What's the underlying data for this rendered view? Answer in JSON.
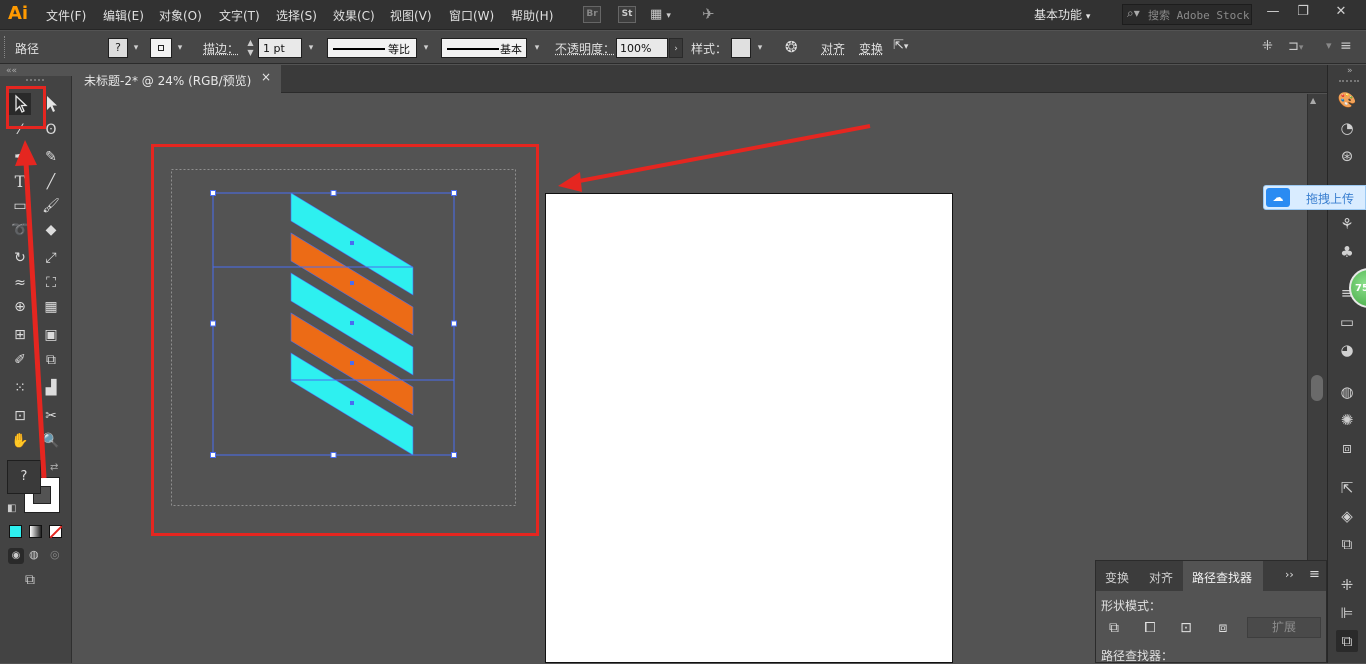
{
  "app": {
    "logo": "Ai",
    "menu": [
      "文件(F)",
      "编辑(E)",
      "对象(O)",
      "文字(T)",
      "选择(S)",
      "效果(C)",
      "视图(V)",
      "窗口(W)",
      "帮助(H)"
    ],
    "bridge_label": "Br",
    "stock_label": "St",
    "workspace": "基本功能",
    "search_placeholder": "搜索 Adobe Stock",
    "win_controls": [
      "—",
      "❐",
      "✕"
    ]
  },
  "control_bar": {
    "selection_type": "路径",
    "fill_label": "?",
    "stroke_label": "描边",
    "stroke_weight": "1 pt",
    "profile_label": "等比",
    "brush_label": "基本",
    "opacity_label": "不透明度",
    "opacity_value": "100%",
    "style_label": "样式",
    "align_label": "对齐",
    "transform_label": "变换"
  },
  "document": {
    "tab_title": "未标题-2* @ 24% (RGB/预览)",
    "close_glyph": "×"
  },
  "tools": {
    "fill_unknown": "?"
  },
  "upload": {
    "label": "拖拽上传"
  },
  "badge": {
    "value": "75"
  },
  "pathfinder": {
    "tabs": [
      "变换",
      "对齐",
      "路径查找器"
    ],
    "active_tab": "路径查找器",
    "shape_modes_label": "形状模式：",
    "pathfinders_label": "路径查找器：",
    "expand_label": "扩展"
  },
  "colors": {
    "stripe_cyan": "#2ef0f0",
    "stripe_orange": "#ec6b16",
    "annotation_red": "#e52620",
    "selection_blue": "#4a6cf0"
  }
}
